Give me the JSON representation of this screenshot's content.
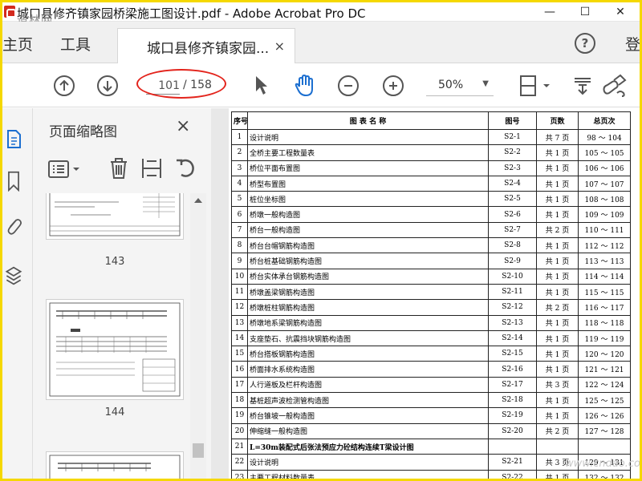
{
  "window": {
    "title": "城口县修齐镇家园桥梁施工图设计.pdf - Adobe Acrobat Pro DC",
    "watermark_top": "道林网",
    "controls": {
      "minimize": "—",
      "maximize": "☐",
      "close": "✕"
    }
  },
  "tabs": {
    "home": "主页",
    "tools": "工具",
    "document": "城口县修齐镇家园...",
    "close": "×",
    "help": "?",
    "login": "登"
  },
  "toolbar": {
    "current_page": "101",
    "total_pages": "/ 158",
    "zoom": "50%",
    "annotation_color": "#e3241c",
    "icons": [
      "arrow-up-icon",
      "arrow-down-icon",
      "select-cursor-icon",
      "hand-tool-icon",
      "zoom-out-icon",
      "zoom-in-icon",
      "page-fit-icon",
      "stamp-icon",
      "sign-icon"
    ]
  },
  "sidebar": {
    "icons": [
      "pages-icon",
      "bookmark-icon",
      "attachment-icon",
      "layers-icon"
    ]
  },
  "thumbnail_panel": {
    "title": "页面缩略图",
    "close": "×",
    "thumbnails": [
      {
        "page": "143"
      },
      {
        "page": "144"
      },
      {
        "page": ""
      }
    ]
  },
  "document": {
    "headers": {
      "no": "序号",
      "name": "图 表 名 称",
      "code": "图号",
      "pages": "页数",
      "total": "总页次"
    },
    "rows": [
      {
        "no": "1",
        "name": "设计说明",
        "code": "S2-1",
        "pages": "共 7 页",
        "total": "98 ～ 104"
      },
      {
        "no": "2",
        "name": "全桥主要工程数量表",
        "code": "S2-2",
        "pages": "共 1 页",
        "total": "105 ～ 105"
      },
      {
        "no": "3",
        "name": "桥位平面布置图",
        "code": "S2-3",
        "pages": "共 1 页",
        "total": "106 ～ 106"
      },
      {
        "no": "4",
        "name": "桥型布置图",
        "code": "S2-4",
        "pages": "共 1 页",
        "total": "107 ～ 107"
      },
      {
        "no": "5",
        "name": "桩位坐标图",
        "code": "S2-5",
        "pages": "共 1 页",
        "total": "108 ～ 108"
      },
      {
        "no": "6",
        "name": "桥墩一般构造图",
        "code": "S2-6",
        "pages": "共 1 页",
        "total": "109 ～ 109"
      },
      {
        "no": "7",
        "name": "桥台一般构造图",
        "code": "S2-7",
        "pages": "共 2 页",
        "total": "110 ～ 111"
      },
      {
        "no": "8",
        "name": "桥台台帽钢筋构造图",
        "code": "S2-8",
        "pages": "共 1 页",
        "total": "112 ～ 112"
      },
      {
        "no": "9",
        "name": "桥台桩基础钢筋构造图",
        "code": "S2-9",
        "pages": "共 1 页",
        "total": "113 ～ 113"
      },
      {
        "no": "10",
        "name": "桥台实体承台钢筋构造图",
        "code": "S2-10",
        "pages": "共 1 页",
        "total": "114 ～ 114"
      },
      {
        "no": "11",
        "name": "桥墩盖梁钢筋构造图",
        "code": "S2-11",
        "pages": "共 1 页",
        "total": "115 ～ 115"
      },
      {
        "no": "12",
        "name": "桥墩桩柱钢筋构造图",
        "code": "S2-12",
        "pages": "共 2 页",
        "total": "116 ～ 117"
      },
      {
        "no": "13",
        "name": "桥墩地系梁钢筋构造图",
        "code": "S2-13",
        "pages": "共 1 页",
        "total": "118 ～ 118"
      },
      {
        "no": "14",
        "name": "支座垫石、抗震挡块钢筋构造图",
        "code": "S2-14",
        "pages": "共 1 页",
        "total": "119 ～ 119"
      },
      {
        "no": "15",
        "name": "桥台搭板钢筋构造图",
        "code": "S2-15",
        "pages": "共 1 页",
        "total": "120 ～ 120"
      },
      {
        "no": "16",
        "name": "桥面排水系统构造图",
        "code": "S2-16",
        "pages": "共 1 页",
        "total": "121 ～ 121"
      },
      {
        "no": "17",
        "name": "人行道板及栏杆构造图",
        "code": "S2-17",
        "pages": "共 3 页",
        "total": "122 ～ 124"
      },
      {
        "no": "18",
        "name": "基桩超声波检测管构造图",
        "code": "S2-18",
        "pages": "共 1 页",
        "total": "125 ～ 125"
      },
      {
        "no": "19",
        "name": "桥台锥坡一般构造图",
        "code": "S2-19",
        "pages": "共 1 页",
        "total": "126 ～ 126"
      },
      {
        "no": "20",
        "name": "伸缩缝一般构造图",
        "code": "S2-20",
        "pages": "共 2 页",
        "total": "127 ～ 128"
      },
      {
        "no": "21",
        "name": "L=30m装配式后张法预应力砼结构连续T梁设计图",
        "code": "",
        "pages": "",
        "total": "",
        "section": true
      },
      {
        "no": "22",
        "name": "设计说明",
        "code": "S2-21",
        "pages": "共 3 页",
        "total": "129 ～ 131"
      },
      {
        "no": "23",
        "name": "主要工程材料数量表",
        "code": "S2-22",
        "pages": "共 1 页",
        "total": "132 ～ 132"
      }
    ],
    "watermark": "www.cndao.com"
  }
}
